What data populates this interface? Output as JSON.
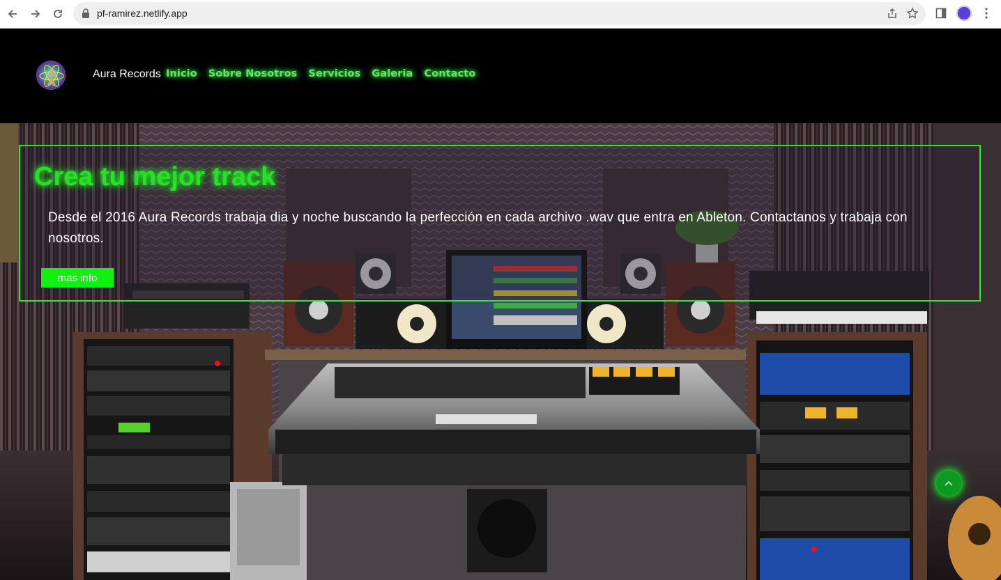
{
  "browser": {
    "url": "pf-ramirez.netlify.app",
    "icons": [
      "back-arrow-icon",
      "forward-arrow-icon",
      "reload-icon",
      "lock-icon",
      "share-icon",
      "star-icon",
      "side-panel-icon",
      "profile-avatar",
      "more-menu-icon"
    ]
  },
  "header": {
    "brand": "Aura Records",
    "nav": [
      "Inicio",
      "Sobre Nosotros",
      "Servicios",
      "Galeria",
      "Contacto"
    ],
    "nav_color": "#76d67a"
  },
  "hero": {
    "title": "Crea tu mejor track",
    "text": "Desde el 2016 Aura Records trabaja dia y noche buscando la perfección en cada archivo .wav que entra en Ableton. Contactanos y trabaja con nosotros.",
    "button_label": "mas info",
    "accent_color": "#1cf51c"
  },
  "scroll_top_icon": "chevron-up-icon"
}
